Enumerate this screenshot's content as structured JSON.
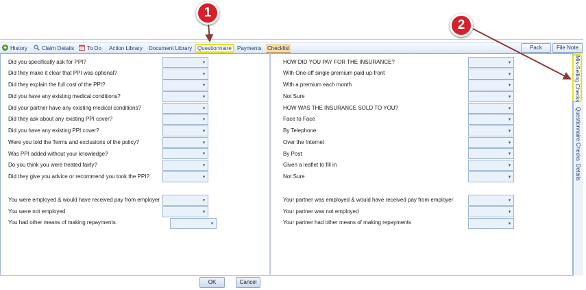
{
  "toolbar": {
    "tabs": [
      "History",
      "Claim Details",
      "To Do",
      "Action Library",
      "Document Library",
      "Questionnaire",
      "Payments",
      "Checklist"
    ],
    "active_tab": "Questionnaire",
    "pack_label": "Pack",
    "file_note_label": "File Note"
  },
  "side_tabs": [
    "Mis-Selling Checks",
    "Questionnaire Checks",
    "Details"
  ],
  "left_questions": [
    "Did you specifically ask for PPI?",
    "Did they make it clear that PPI was optional?",
    "Did they explain the full cost of the PPI?",
    "Did you have any existing medical conditions?",
    "Did your partner have any existing medical conditions?",
    "Did they ask about any existing PPI cover?",
    "Did you have any existing PPI cover?",
    "Were you told the Terms and exclusions of the policy?",
    "Was PPI added without your knowledge?",
    "Do you think you were treated fairly?",
    "Did they give you advice or recommend you took the PPI?"
  ],
  "left_employment": [
    "You were employed & would have received pay from employer",
    "You were not employed",
    "You had other means of making repayments"
  ],
  "right_questions": [
    "HOW DID YOU PAY FOR THE INSURANCE?",
    "With One-off single premium paid up-front",
    "With a premium each month",
    "Not Sure",
    "HOW WAS THE INSURANCE SOLD TO YOU?",
    "Face to Face",
    "By Telephone",
    "Over the Internet",
    "By Post",
    "Given a leaflet to fill in",
    "Not Sure"
  ],
  "right_employment": [
    "Your partner was employed & would have received pay from employer",
    "Your partner was not employed",
    "Your partner had other means of making repayments"
  ],
  "dropdown_arrow": "▾",
  "buttons": {
    "ok": "OK",
    "cancel": "Cancel"
  },
  "callouts": [
    "1",
    "2"
  ],
  "colors": {
    "callout": "#d6212a",
    "highlight": "#e6e21c",
    "arrow": "#8b3a3a",
    "checklist_bg": "#f7d9a7"
  }
}
